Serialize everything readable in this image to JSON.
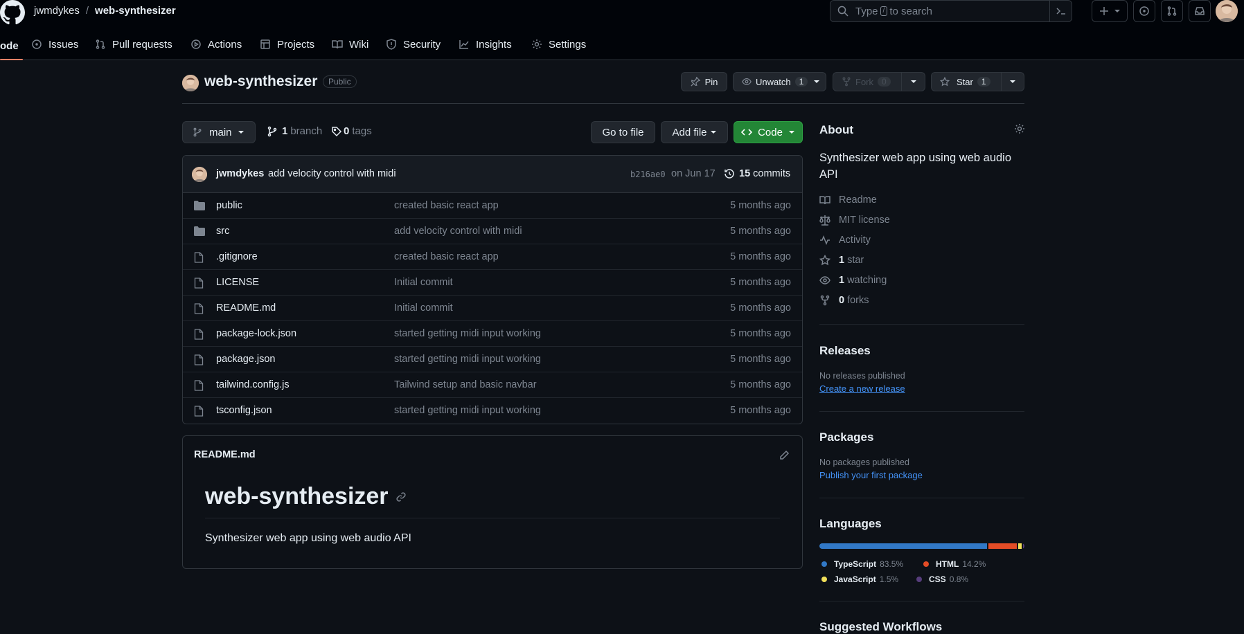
{
  "header": {
    "owner": "jwmdykes",
    "separator": "/",
    "repo": "web-synthesizer",
    "search_placeholder_prefix": "Type",
    "search_placeholder_key": "/",
    "search_placeholder_suffix": "to search"
  },
  "nav": {
    "code": "ode",
    "issues": "Issues",
    "pull_requests": "Pull requests",
    "actions": "Actions",
    "projects": "Projects",
    "wiki": "Wiki",
    "security": "Security",
    "insights": "Insights",
    "settings": "Settings"
  },
  "repo_header": {
    "name": "web-synthesizer",
    "visibility": "Public",
    "pin": "Pin",
    "unwatch": "Unwatch",
    "watch_count": "1",
    "fork": "Fork",
    "fork_count": "0",
    "star": "Star",
    "star_count": "1"
  },
  "toolbar": {
    "branch": "main",
    "branch_count": "1",
    "branch_label": "branch",
    "tag_count": "0",
    "tag_label": "tags",
    "go_to_file": "Go to file",
    "add_file": "Add file",
    "code": "Code"
  },
  "commit": {
    "author": "jwmdykes",
    "message": "add velocity control with midi",
    "sha": "b216ae0",
    "date": "on Jun 17",
    "count": "15",
    "count_label": "commits"
  },
  "files": [
    {
      "name": "public",
      "type": "dir",
      "message": "created basic react app",
      "age": "5 months ago"
    },
    {
      "name": "src",
      "type": "dir",
      "message": "add velocity control with midi",
      "age": "5 months ago"
    },
    {
      "name": ".gitignore",
      "type": "file",
      "message": "created basic react app",
      "age": "5 months ago"
    },
    {
      "name": "LICENSE",
      "type": "file",
      "message": "Initial commit",
      "age": "5 months ago"
    },
    {
      "name": "README.md",
      "type": "file",
      "message": "Initial commit",
      "age": "5 months ago"
    },
    {
      "name": "package-lock.json",
      "type": "file",
      "message": "started getting midi input working",
      "age": "5 months ago"
    },
    {
      "name": "package.json",
      "type": "file",
      "message": "started getting midi input working",
      "age": "5 months ago"
    },
    {
      "name": "tailwind.config.js",
      "type": "file",
      "message": "Tailwind setup and basic navbar",
      "age": "5 months ago"
    },
    {
      "name": "tsconfig.json",
      "type": "file",
      "message": "started getting midi input working",
      "age": "5 months ago"
    }
  ],
  "readme": {
    "filename": "README.md",
    "heading": "web-synthesizer",
    "description": "Synthesizer web app using web audio API"
  },
  "about": {
    "title": "About",
    "description": "Synthesizer web app using web audio API",
    "readme": "Readme",
    "license": "MIT license",
    "activity": "Activity",
    "stars_count": "1",
    "stars_label": "star",
    "watching_count": "1",
    "watching_label": "watching",
    "forks_count": "0",
    "forks_label": "forks"
  },
  "releases": {
    "title": "Releases",
    "none": "No releases published",
    "create": "Create a new release"
  },
  "packages": {
    "title": "Packages",
    "none": "No packages published",
    "publish": "Publish your first package"
  },
  "languages": {
    "title": "Languages",
    "items": [
      {
        "name": "TypeScript",
        "percent": "83.5%",
        "value": 83.5,
        "color": "#3178c6"
      },
      {
        "name": "HTML",
        "percent": "14.2%",
        "value": 14.2,
        "color": "#e34c26"
      },
      {
        "name": "JavaScript",
        "percent": "1.5%",
        "value": 1.5,
        "color": "#f1e05a"
      },
      {
        "name": "CSS",
        "percent": "0.8%",
        "value": 0.8,
        "color": "#563d7c"
      }
    ]
  },
  "workflows": {
    "title": "Suggested Workflows"
  }
}
